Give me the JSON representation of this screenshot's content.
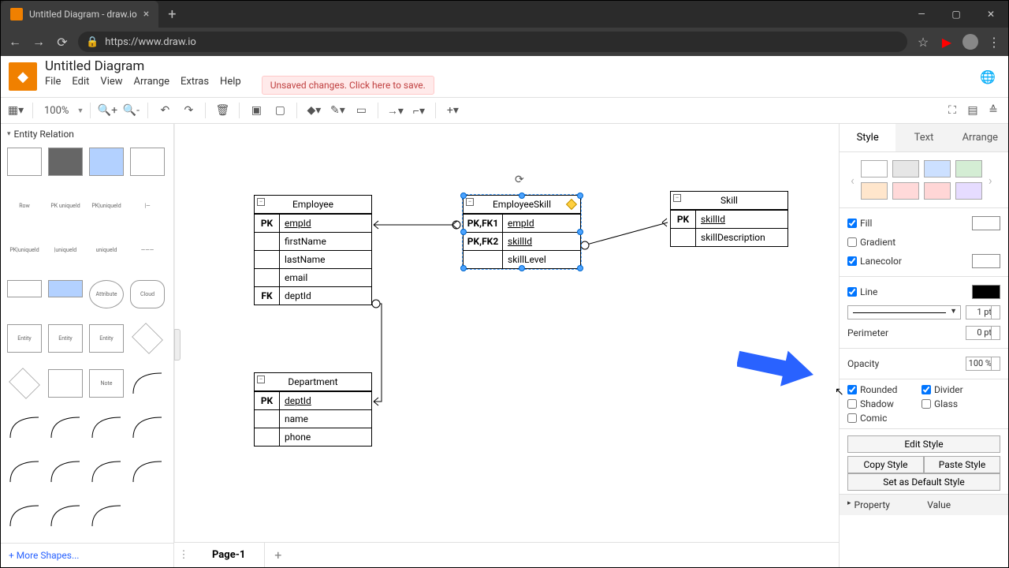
{
  "browser": {
    "tab_title": "Untitled Diagram - draw.io",
    "url": "https://www.draw.io"
  },
  "app": {
    "title": "Untitled Diagram",
    "menu": [
      "File",
      "Edit",
      "View",
      "Arrange",
      "Extras",
      "Help"
    ],
    "save_prompt": "Unsaved changes. Click here to save."
  },
  "toolbar": {
    "zoom": "100%"
  },
  "palette": {
    "section": "Entity Relation",
    "more_shapes": "+ More Shapes..."
  },
  "entities": {
    "employee": {
      "title": "Employee",
      "rows": [
        {
          "key": "PK",
          "val": "empId",
          "underline": true
        },
        {
          "key": "",
          "val": "firstName"
        },
        {
          "key": "",
          "val": "lastName"
        },
        {
          "key": "",
          "val": "email"
        },
        {
          "key": "FK",
          "val": "deptId"
        }
      ]
    },
    "department": {
      "title": "Department",
      "rows": [
        {
          "key": "PK",
          "val": "deptId",
          "underline": true
        },
        {
          "key": "",
          "val": "name"
        },
        {
          "key": "",
          "val": "phone"
        }
      ]
    },
    "employeeSkill": {
      "title": "EmployeeSkill",
      "rows": [
        {
          "key": "PK,FK1",
          "val": "empId",
          "underline": true
        },
        {
          "key": "PK,FK2",
          "val": "skillId",
          "underline": true
        },
        {
          "key": "",
          "val": "skillLevel"
        }
      ]
    },
    "skill": {
      "title": "Skill",
      "rows": [
        {
          "key": "PK",
          "val": "skillId",
          "underline": true
        },
        {
          "key": "",
          "val": "skillDescription"
        }
      ]
    }
  },
  "style_panel": {
    "tabs": [
      "Style",
      "Text",
      "Arrange"
    ],
    "swatches_top": [
      "#ffffff",
      "#e6e6e6",
      "#cce0ff",
      "#d4edd4"
    ],
    "swatches_bot": [
      "#ffe6cc",
      "#ffd9d9",
      "#ffd6d6",
      "#e6dcff"
    ],
    "fill": {
      "label": "Fill",
      "checked": true,
      "color": "#ffffff"
    },
    "gradient": {
      "label": "Gradient",
      "checked": false
    },
    "lanecolor": {
      "label": "Lanecolor",
      "checked": true,
      "color": "#ffffff"
    },
    "line": {
      "label": "Line",
      "checked": true,
      "color": "#000000",
      "width": "1 pt"
    },
    "perimeter": {
      "label": "Perimeter",
      "value": "0 pt"
    },
    "opacity": {
      "label": "Opacity",
      "value": "100 %"
    },
    "checks": {
      "rounded": {
        "label": "Rounded",
        "checked": true
      },
      "divider": {
        "label": "Divider",
        "checked": true
      },
      "shadow": {
        "label": "Shadow",
        "checked": false
      },
      "glass": {
        "label": "Glass",
        "checked": false
      },
      "comic": {
        "label": "Comic",
        "checked": false
      }
    },
    "buttons": {
      "edit_style": "Edit Style",
      "copy_style": "Copy Style",
      "paste_style": "Paste Style",
      "set_default": "Set as Default Style"
    },
    "proptable": {
      "col1": "Property",
      "col2": "Value"
    }
  },
  "pages": {
    "page1": "Page-1"
  }
}
